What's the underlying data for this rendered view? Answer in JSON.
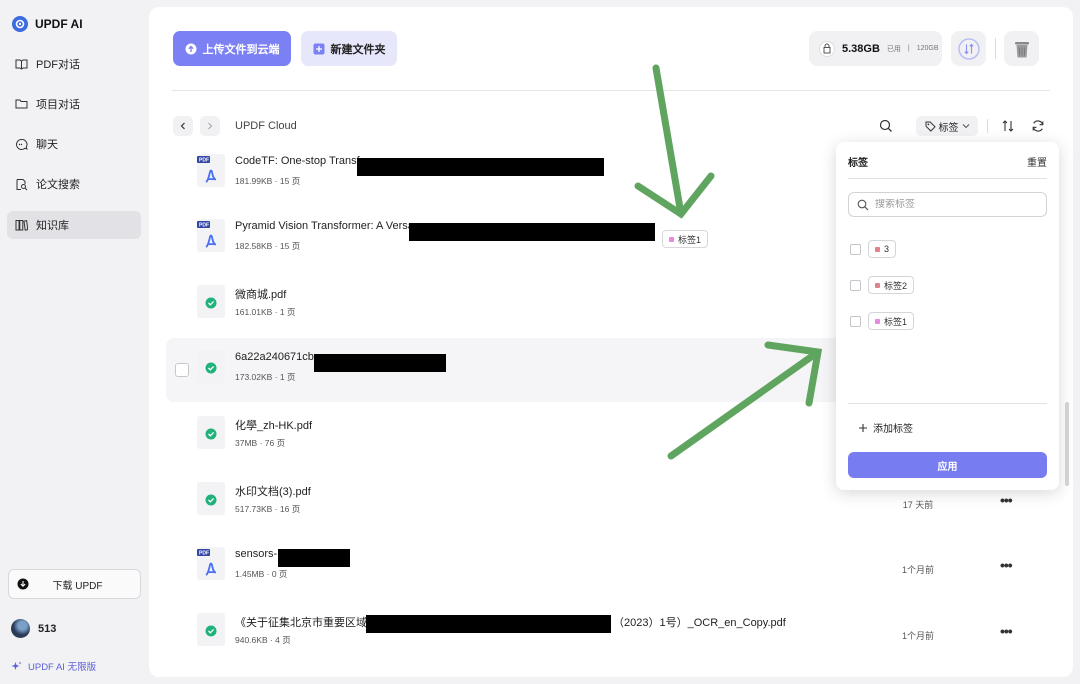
{
  "sidebar": {
    "brand": "UPDF AI",
    "items": [
      {
        "label": "PDF对话"
      },
      {
        "label": "项目对话"
      },
      {
        "label": "聊天"
      },
      {
        "label": "论文搜索"
      },
      {
        "label": "知识库",
        "active": true
      }
    ],
    "download_label": "下载 UPDF",
    "user_name": "513",
    "promo_label": "UPDF AI 无限版"
  },
  "toolbar": {
    "upload_label": "上传文件到云端",
    "new_folder_label": "新建文件夹",
    "storage_used": "5.38GB",
    "storage_used_suffix": "已用",
    "storage_total": "120GB",
    "breadcrumb": "UPDF Cloud",
    "tag_filter_label": "标签"
  },
  "files": [
    {
      "name": "CodeTF: One-stop Transf",
      "meta": "181.99KB · 15 页",
      "icon": "pdf-icon",
      "date": "",
      "redacted": true
    },
    {
      "name": "Pyramid Vision Transformer: A Versa",
      "meta": "182.58KB · 15 页",
      "icon": "pdf-icon",
      "date": "",
      "redacted": true,
      "tag": "标签1"
    },
    {
      "name": "微商城.pdf",
      "meta": "161.01KB · 1 页",
      "icon": "check-file-icon",
      "date": ""
    },
    {
      "name": "6a22a240671cb",
      "meta": "173.02KB · 1 页",
      "icon": "check-file-icon",
      "date": "",
      "redacted": true,
      "hovered": true
    },
    {
      "name": "化學_zh-HK.pdf",
      "meta": "37MB · 76 页",
      "icon": "check-file-icon",
      "date": ""
    },
    {
      "name": "水印文档(3).pdf",
      "meta": "517.73KB · 16 页",
      "icon": "check-file-icon",
      "date": "17 天前"
    },
    {
      "name": "sensors-",
      "meta": "1.45MB · 0 页",
      "icon": "pdf-icon",
      "date": "1个月前",
      "redacted": true
    },
    {
      "name": "《关于征集北京市重要区域",
      "name_suffix": "（2023）1号）_OCR_en_Copy.pdf",
      "meta": "940.6KB · 4 页",
      "icon": "check-file-icon",
      "date": "1个月前",
      "redacted": true
    }
  ],
  "tag_popup": {
    "title": "标签",
    "reset_label": "重置",
    "search_placeholder": "搜索标签",
    "tags": [
      {
        "label": "3",
        "color": "#e0828c"
      },
      {
        "label": "标签2",
        "color": "#e0828c"
      },
      {
        "label": "标签1",
        "color": "#e58ae0"
      }
    ],
    "add_label": "添加标签",
    "apply_label": "应用"
  },
  "colors": {
    "accent": "#7b80f3",
    "annotation_arrow": "#5fa55f",
    "check_icon": "#20b27a"
  }
}
